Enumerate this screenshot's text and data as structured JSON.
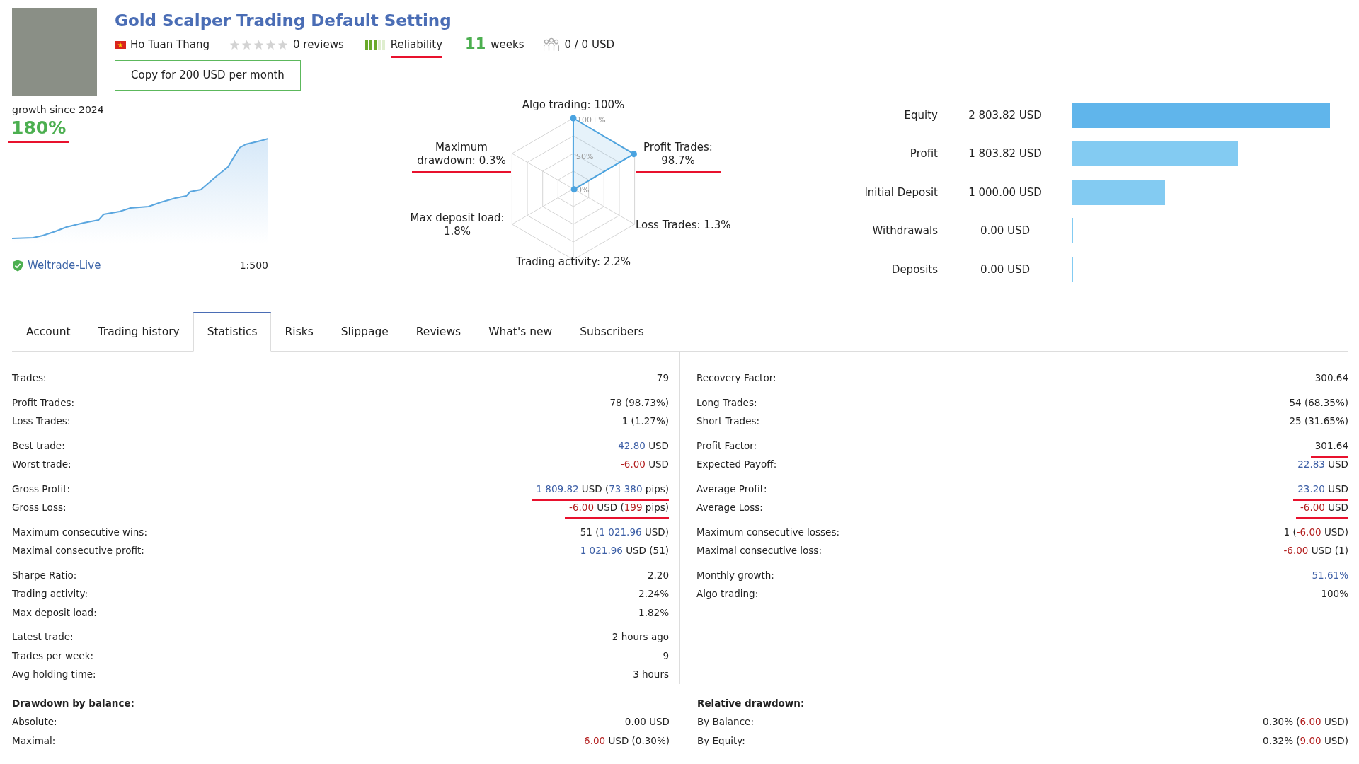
{
  "header": {
    "title": "Gold Scalper Trading Default Setting",
    "author": "Ho Tuan Thang",
    "rating": {
      "stars": 0,
      "reviews": "0 reviews"
    },
    "reliability": {
      "label": "Reliability",
      "level": 0.6,
      "underlined": true
    },
    "weeks": {
      "number": "11",
      "unit": "weeks"
    },
    "subscribers": "0 / 0 USD",
    "copy_button": "Copy for 200 USD per month"
  },
  "growth": {
    "caption": "growth since 2024",
    "value": "180%",
    "underlined": true,
    "broker": "Weltrade-Live",
    "leverage": "1:500"
  },
  "radar": {
    "ring_labels": [
      "100+%",
      "50%",
      "0%"
    ],
    "axes": [
      {
        "label": "Algo trading: 100%",
        "underlined": false
      },
      {
        "label": "Maximum drawdown: 0.3%",
        "underlined": true
      },
      {
        "label": "Profit Trades: 98.7%",
        "underlined": true
      },
      {
        "label": "Max deposit load: 1.8%",
        "underlined": false
      },
      {
        "label": "Loss Trades: 1.3%",
        "underlined": false
      },
      {
        "label": "Trading activity: 2.2%",
        "underlined": false
      }
    ]
  },
  "balance_bars": [
    {
      "label": "Equity",
      "value": "2 803.82 USD",
      "level": 1,
      "color": "#60b5eb"
    },
    {
      "label": "Profit",
      "value": "1 803.82 USD",
      "level": 0.643,
      "color": "#83cbf2"
    },
    {
      "label": "Initial Deposit",
      "value": "1 000.00 USD",
      "level": 0.357,
      "color": "#83cbf2"
    },
    {
      "label": "Withdrawals",
      "value": "0.00 USD",
      "level": 0,
      "color": "#83cbf2"
    },
    {
      "label": "Deposits",
      "value": "0.00 USD",
      "level": 0,
      "color": "#83cbf2"
    }
  ],
  "tabs": [
    {
      "label": "Account",
      "selected": false
    },
    {
      "label": "Trading history",
      "selected": false
    },
    {
      "label": "Statistics",
      "selected": true
    },
    {
      "label": "Risks",
      "selected": false
    },
    {
      "label": "Slippage",
      "selected": false
    },
    {
      "label": "Reviews",
      "selected": false
    },
    {
      "label": "What's new",
      "selected": false
    },
    {
      "label": "Subscribers",
      "selected": false
    }
  ],
  "statistics": {
    "columns": [
      {
        "groups": [
          [
            {
              "label": "Trades:",
              "underlined": false,
              "value": [
                {
                  "text": "79",
                  "kind": "plain"
                }
              ]
            }
          ],
          [
            {
              "label": "Profit Trades:",
              "underlined": false,
              "value": [
                {
                  "text": "78 (98.73%)",
                  "kind": "plain"
                }
              ]
            },
            {
              "label": "Loss Trades:",
              "underlined": false,
              "value": [
                {
                  "text": "1 (1.27%)",
                  "kind": "plain"
                }
              ]
            }
          ],
          [
            {
              "label": "Best trade:",
              "underlined": false,
              "value": [
                {
                  "text": "42.80",
                  "kind": "positive"
                },
                {
                  "text": " USD",
                  "kind": "plain"
                }
              ]
            },
            {
              "label": "Worst trade:",
              "underlined": false,
              "value": [
                {
                  "text": "-6.00",
                  "kind": "negative"
                },
                {
                  "text": " USD",
                  "kind": "plain"
                }
              ]
            }
          ],
          [
            {
              "label": "Gross Profit:",
              "underlined": true,
              "value": [
                {
                  "text": "1 809.82",
                  "kind": "positive"
                },
                {
                  "text": " USD (",
                  "kind": "plain"
                },
                {
                  "text": "73 380",
                  "kind": "positive"
                },
                {
                  "text": " pips)",
                  "kind": "plain"
                }
              ]
            },
            {
              "label": "Gross Loss:",
              "underlined": true,
              "value": [
                {
                  "text": "-6.00",
                  "kind": "negative"
                },
                {
                  "text": " USD (",
                  "kind": "plain"
                },
                {
                  "text": "199",
                  "kind": "negative"
                },
                {
                  "text": " pips)",
                  "kind": "plain"
                }
              ]
            }
          ],
          [
            {
              "label": "Maximum consecutive wins:",
              "underlined": false,
              "value": [
                {
                  "text": "51 (",
                  "kind": "plain"
                },
                {
                  "text": "1 021.96",
                  "kind": "positive"
                },
                {
                  "text": " USD)",
                  "kind": "plain"
                }
              ]
            },
            {
              "label": "Maximal consecutive profit:",
              "underlined": false,
              "value": [
                {
                  "text": "1 021.96",
                  "kind": "positive"
                },
                {
                  "text": " USD (51)",
                  "kind": "plain"
                }
              ]
            }
          ],
          [
            {
              "label": "Sharpe Ratio:",
              "underlined": false,
              "value": [
                {
                  "text": "2.20",
                  "kind": "plain"
                }
              ]
            },
            {
              "label": "Trading activity:",
              "underlined": false,
              "value": [
                {
                  "text": "2.24%",
                  "kind": "plain"
                }
              ]
            },
            {
              "label": "Max deposit load:",
              "underlined": false,
              "value": [
                {
                  "text": "1.82%",
                  "kind": "plain"
                }
              ]
            }
          ],
          [
            {
              "label": "Latest trade:",
              "underlined": false,
              "value": [
                {
                  "text": "2 hours ago",
                  "kind": "plain"
                }
              ]
            },
            {
              "label": "Trades per week:",
              "underlined": false,
              "value": [
                {
                  "text": "9",
                  "kind": "plain"
                }
              ]
            },
            {
              "label": "Avg holding time:",
              "underlined": false,
              "value": [
                {
                  "text": "3 hours",
                  "kind": "plain"
                }
              ]
            }
          ]
        ],
        "section": {
          "heading": "Drawdown by balance:",
          "rows": [
            {
              "label": "Absolute:",
              "underlined": false,
              "value": [
                {
                  "text": "0.00 USD",
                  "kind": "plain"
                }
              ]
            },
            {
              "label": "Maximal:",
              "underlined": false,
              "value": [
                {
                  "text": "6.00",
                  "kind": "negative"
                },
                {
                  "text": " USD (0.30%)",
                  "kind": "plain"
                }
              ]
            }
          ]
        }
      },
      {
        "groups": [
          [
            {
              "label": "Recovery Factor:",
              "underlined": false,
              "value": [
                {
                  "text": "300.64",
                  "kind": "plain"
                }
              ]
            }
          ],
          [
            {
              "label": "Long Trades:",
              "underlined": false,
              "value": [
                {
                  "text": "54 (68.35%)",
                  "kind": "plain"
                }
              ]
            },
            {
              "label": "Short Trades:",
              "underlined": false,
              "value": [
                {
                  "text": "25 (31.65%)",
                  "kind": "plain"
                }
              ]
            }
          ],
          [
            {
              "label": "Profit Factor:",
              "underlined": true,
              "value": [
                {
                  "text": "301.64",
                  "kind": "plain"
                }
              ]
            },
            {
              "label": "Expected Payoff:",
              "underlined": false,
              "value": [
                {
                  "text": "22.83",
                  "kind": "positive"
                },
                {
                  "text": " USD",
                  "kind": "plain"
                }
              ]
            }
          ],
          [
            {
              "label": "Average Profit:",
              "underlined": true,
              "value": [
                {
                  "text": "23.20",
                  "kind": "positive"
                },
                {
                  "text": " USD",
                  "kind": "plain"
                }
              ]
            },
            {
              "label": "Average Loss:",
              "underlined": true,
              "value": [
                {
                  "text": "-6.00",
                  "kind": "negative"
                },
                {
                  "text": " USD",
                  "kind": "plain"
                }
              ]
            }
          ],
          [
            {
              "label": "Maximum consecutive losses:",
              "underlined": false,
              "value": [
                {
                  "text": "1 (",
                  "kind": "plain"
                },
                {
                  "text": "-6.00",
                  "kind": "negative"
                },
                {
                  "text": " USD)",
                  "kind": "plain"
                }
              ]
            },
            {
              "label": "Maximal consecutive loss:",
              "underlined": false,
              "value": [
                {
                  "text": "-6.00",
                  "kind": "negative"
                },
                {
                  "text": " USD (1)",
                  "kind": "plain"
                }
              ]
            }
          ],
          [
            {
              "label": "Monthly growth:",
              "underlined": false,
              "value": [
                {
                  "text": "51.61%",
                  "kind": "positive"
                }
              ]
            },
            {
              "label": "Algo trading:",
              "underlined": false,
              "value": [
                {
                  "text": "100%",
                  "kind": "plain"
                }
              ]
            }
          ]
        ],
        "section": {
          "heading": "Relative drawdown:",
          "rows": [
            {
              "label": "By Balance:",
              "underlined": false,
              "value": [
                {
                  "text": "0.30% (",
                  "kind": "plain"
                },
                {
                  "text": "6.00",
                  "kind": "negative"
                },
                {
                  "text": " USD)",
                  "kind": "plain"
                }
              ]
            },
            {
              "label": "By Equity:",
              "underlined": false,
              "value": [
                {
                  "text": "0.32% (",
                  "kind": "plain"
                },
                {
                  "text": "9.00",
                  "kind": "negative"
                },
                {
                  "text": " USD)",
                  "kind": "plain"
                }
              ]
            }
          ]
        }
      }
    ]
  }
}
